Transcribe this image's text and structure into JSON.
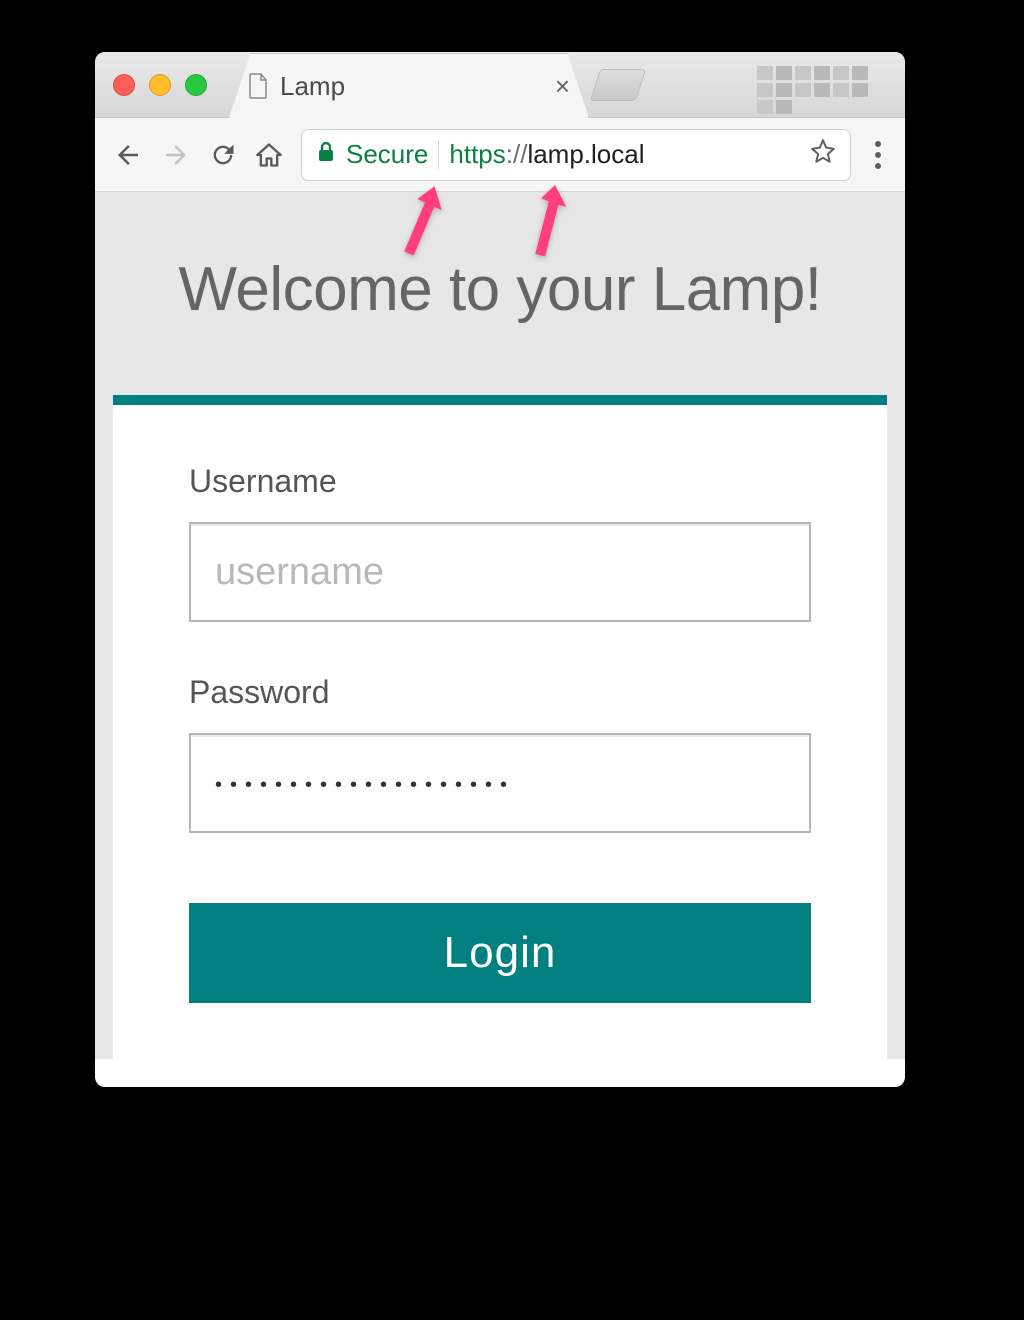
{
  "browser": {
    "tab_title": "Lamp",
    "close_glyph": "×",
    "secure_label": "Secure",
    "url_protocol": "https",
    "url_separator": "://",
    "url_host": "lamp.local"
  },
  "colors": {
    "accent": "#008080",
    "secure_green": "#0b8043",
    "annotation_pink": "#ff3e7f"
  },
  "page": {
    "heading": "Welcome to your Lamp!",
    "username_label": "Username",
    "username_placeholder": "username",
    "username_value": "",
    "password_label": "Password",
    "password_value": "••••••••••••••••••••",
    "login_button": "Login"
  }
}
